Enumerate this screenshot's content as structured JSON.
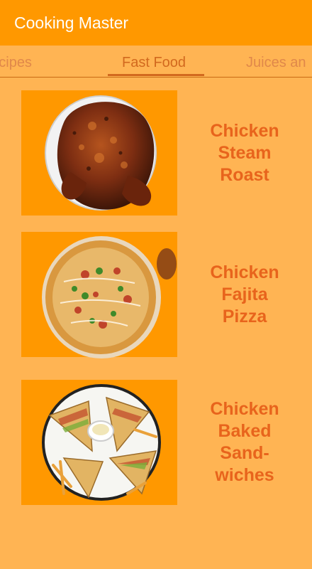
{
  "app": {
    "title": "Cooking Master",
    "colors": {
      "appbar": "#FF9800",
      "background": "#FFB453",
      "accent": "#D2691E",
      "title_text": "#E8641C"
    }
  },
  "tabs": [
    {
      "label": "n Recipes",
      "active": false
    },
    {
      "label": "Fast Food",
      "active": true
    },
    {
      "label": "Juices an",
      "active": false
    }
  ],
  "recipes": [
    {
      "title": "Chicken\nSteam\nRoast",
      "image": "roast-chicken-photo"
    },
    {
      "title": "Chicken\nFajita\nPizza",
      "image": "pizza-photo"
    },
    {
      "title": "Chicken\nBaked\nSand-\nwiches",
      "image": "sandwiches-photo"
    }
  ]
}
